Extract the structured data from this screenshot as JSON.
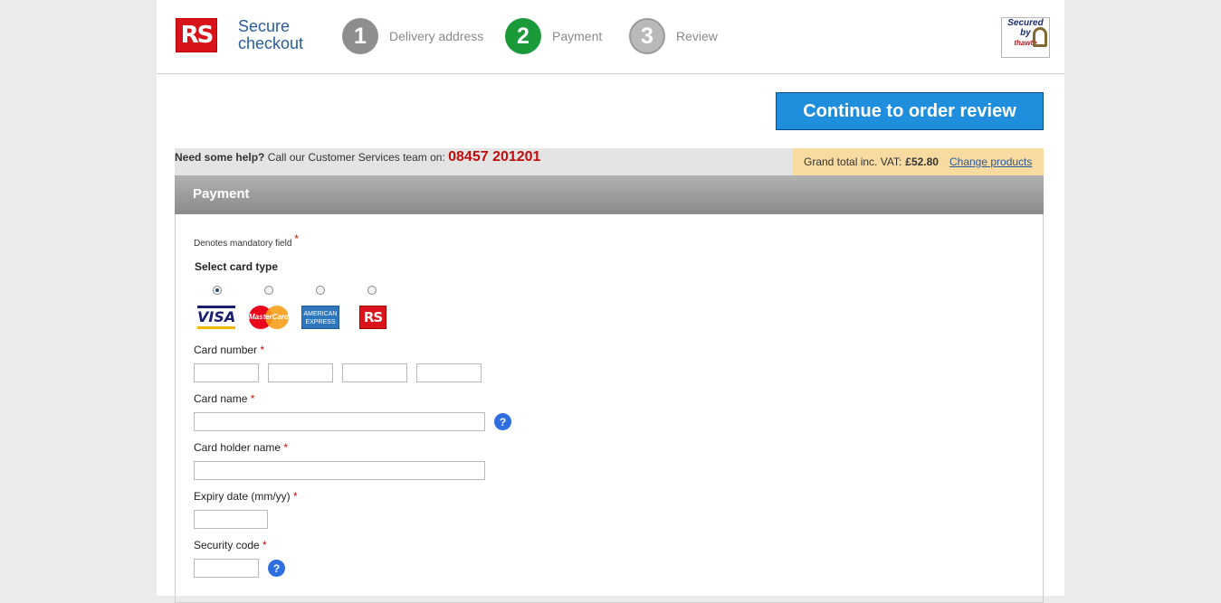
{
  "header": {
    "logo_text": "RS",
    "title_line1": "Secure",
    "title_line2": "checkout",
    "steps": [
      {
        "number": "1",
        "label": "Delivery address"
      },
      {
        "number": "2",
        "label": "Payment"
      },
      {
        "number": "3",
        "label": "Review"
      }
    ],
    "security_badge": {
      "line1": "Secured",
      "line2": "by",
      "brand": "thawte"
    }
  },
  "continue_button": "Continue to order review",
  "help": {
    "prefix": "Need some help?",
    "text": "Call our Customer Services team on:",
    "phone": "08457 201201"
  },
  "total": {
    "label": "Grand total inc. VAT:",
    "amount": "£52.80",
    "change_link": "Change products"
  },
  "payment": {
    "title": "Payment",
    "mandatory_note": "Denotes mandatory field",
    "required_marker": "*",
    "select_card_label": "Select card type",
    "card_types": [
      {
        "name": "VISA",
        "icon": "visa-logo",
        "selected": true
      },
      {
        "name": "MasterCard",
        "icon": "mastercard-logo",
        "selected": false
      },
      {
        "name": "AMERICAN EXPRESS",
        "icon": "amex-logo",
        "selected": false
      },
      {
        "name": "RS",
        "icon": "rs-card-logo",
        "selected": false
      }
    ],
    "fields": {
      "card_number": "Card number",
      "card_name": "Card name",
      "card_holder_name": "Card holder name",
      "expiry_date": "Expiry date (mm/yy)",
      "security_code": "Security code"
    },
    "help_icon_text": "?"
  },
  "colors": {
    "accent_blue": "#1f8fdd",
    "active_step": "#1b9a3a",
    "phone_red": "#c00d0d",
    "total_bg": "#f7dba0"
  }
}
